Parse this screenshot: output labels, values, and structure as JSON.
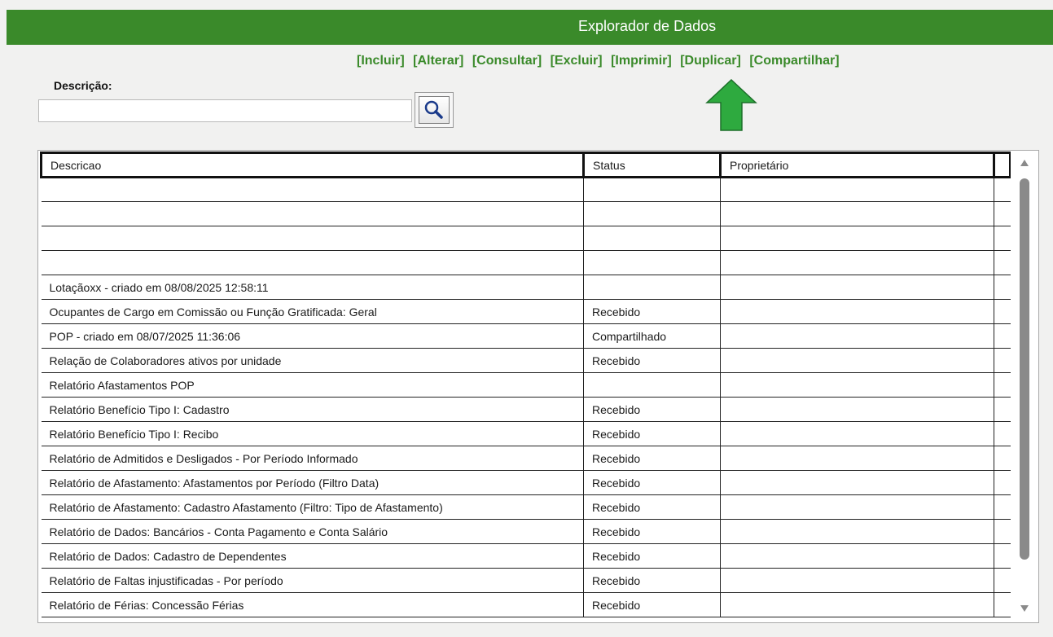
{
  "window": {
    "title": "Explorador de Dados"
  },
  "actions": [
    {
      "label": "[Incluir]"
    },
    {
      "label": "[Alterar]"
    },
    {
      "label": "[Consultar]"
    },
    {
      "label": "[Excluir]"
    },
    {
      "label": "[Imprimir]"
    },
    {
      "label": "[Duplicar]"
    },
    {
      "label": "[Compartilhar]"
    }
  ],
  "search": {
    "label": "Descrição:",
    "value": "",
    "button_icon": "magnifier-icon"
  },
  "table": {
    "columns": [
      "Descricao",
      "Status",
      "Proprietário"
    ],
    "rows": [
      {
        "descricao": "",
        "status": "",
        "proprietario": ""
      },
      {
        "descricao": "",
        "status": "",
        "proprietario": ""
      },
      {
        "descricao": "",
        "status": "",
        "proprietario": ""
      },
      {
        "descricao": "",
        "status": "",
        "proprietario": ""
      },
      {
        "descricao": "Lotaçãoxx - criado em 08/08/2025 12:58:11",
        "status": "",
        "proprietario": ""
      },
      {
        "descricao": "Ocupantes de Cargo em Comissão ou Função Gratificada: Geral",
        "status": "Recebido",
        "proprietario": ""
      },
      {
        "descricao": "POP - criado em 08/07/2025 11:36:06",
        "status": "Compartilhado",
        "proprietario": ""
      },
      {
        "descricao": "Relação de Colaboradores ativos por unidade",
        "status": "Recebido",
        "proprietario": ""
      },
      {
        "descricao": "Relatório Afastamentos POP",
        "status": "",
        "proprietario": ""
      },
      {
        "descricao": "Relatório Benefício Tipo I: Cadastro",
        "status": "Recebido",
        "proprietario": ""
      },
      {
        "descricao": "Relatório Benefício Tipo I: Recibo",
        "status": "Recebido",
        "proprietario": ""
      },
      {
        "descricao": "Relatório de Admitidos e Desligados - Por Período Informado",
        "status": "Recebido",
        "proprietario": ""
      },
      {
        "descricao": "Relatório de Afastamento: Afastamentos por Período (Filtro Data)",
        "status": "Recebido",
        "proprietario": ""
      },
      {
        "descricao": "Relatório de Afastamento: Cadastro Afastamento (Filtro: Tipo de Afastamento)",
        "status": "Recebido",
        "proprietario": ""
      },
      {
        "descricao": "Relatório de Dados: Bancários - Conta Pagamento e Conta Salário",
        "status": "Recebido",
        "proprietario": ""
      },
      {
        "descricao": "Relatório de Dados: Cadastro de Dependentes",
        "status": "Recebido",
        "proprietario": ""
      },
      {
        "descricao": "Relatório de Faltas injustificadas - Por período",
        "status": "Recebido",
        "proprietario": ""
      },
      {
        "descricao": "Relatório de Férias: Concessão Férias",
        "status": "Recebido",
        "proprietario": ""
      }
    ]
  },
  "annotations": {
    "up_arrow": "arrow-up-icon",
    "left_arrow": "arrow-left-icon",
    "color": "#2eaa3f"
  },
  "colors": {
    "brand": "#3a8a2a"
  }
}
